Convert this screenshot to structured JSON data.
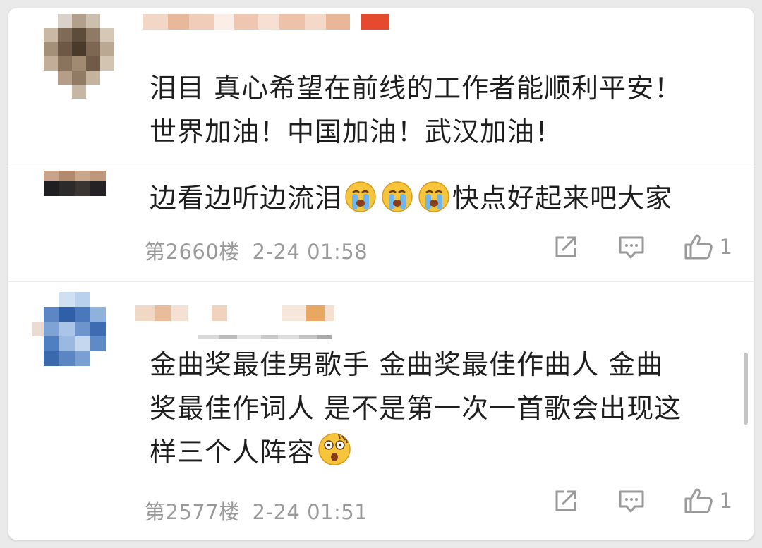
{
  "comments": [
    {
      "text_line1": "泪目 真心希望在前线的工作者能顺利平安！",
      "text_line2": "世界加油！中国加油！武汉加油！"
    },
    {
      "text": "边看边听边流泪",
      "text_suffix": "快点好起来吧大家",
      "emoji": [
        "crying-face-emoji",
        "crying-face-emoji",
        "crying-face-emoji"
      ],
      "floor": "第2660楼",
      "time": "2-24 01:58",
      "like_count": "1"
    },
    {
      "text_line1": "金曲奖最佳男歌手 金曲奖最佳作曲人 金曲",
      "text_line2": "奖最佳作词人 是不是第一次一首歌会出现这",
      "text_line3": "样三个人阵容",
      "emoji": [
        "shocked-face-emoji"
      ],
      "floor": "第2577楼",
      "time": "2-24 01:51",
      "like_count": "1"
    }
  ],
  "icons": {
    "share": "share-icon",
    "reply": "comment-icon",
    "like": "thumbs-up-icon"
  },
  "colors": {
    "text": "#1e1e1e",
    "meta": "#9a9a9a",
    "background": "#ffffff"
  }
}
